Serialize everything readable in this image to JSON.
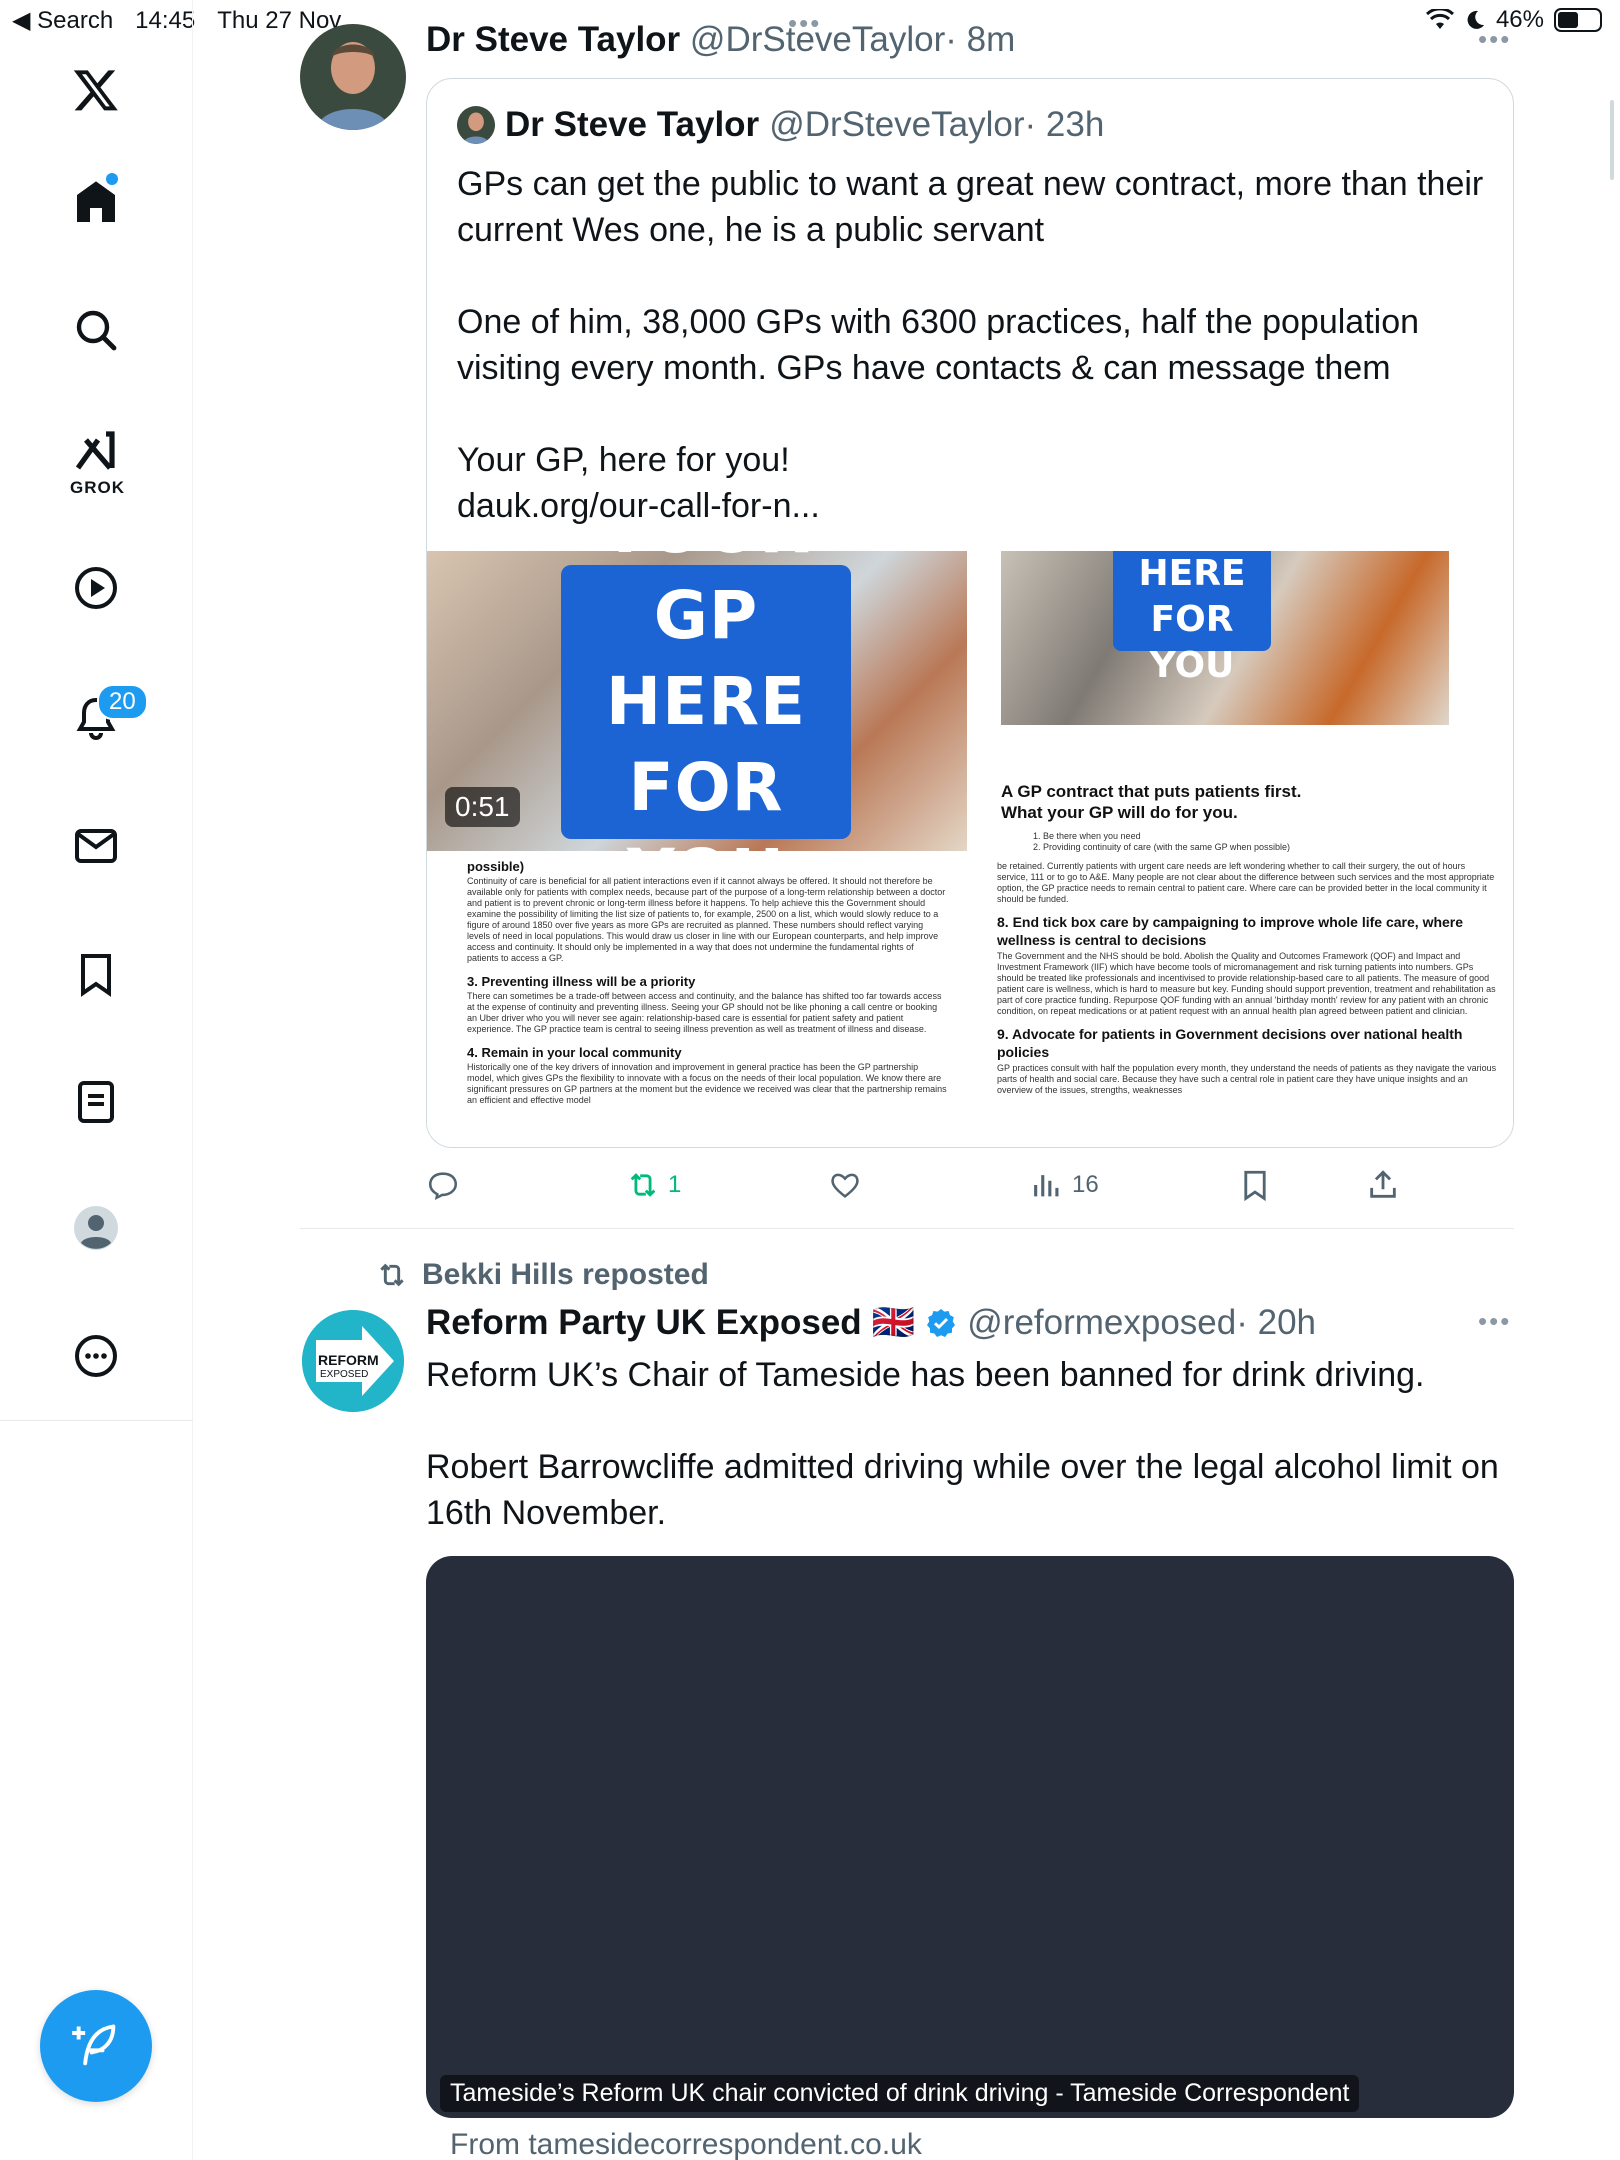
{
  "status_bar": {
    "back_label": "◀ Search",
    "time": "14:45",
    "date": "Thu 27 Nov",
    "battery": "46%"
  },
  "sidebar": {
    "grok_label": "GROK",
    "notifications_badge": "20",
    "items": [
      "home",
      "search",
      "grok",
      "video",
      "notifications",
      "messages",
      "bookmarks",
      "lists",
      "profile",
      "more"
    ]
  },
  "tweet1": {
    "author_name": "Dr Steve Taylor",
    "author_handle": "@DrSteveTaylor",
    "time": "· 8m",
    "quote": {
      "author_name": "Dr Steve Taylor",
      "author_handle": "@DrSteveTaylor",
      "time": "· 23h",
      "paragraphs": [
        "GPs can get the public to want a great new contract, more than their current Wes one, he is a public servant",
        "One of him, 38,000 GPs with 6300 practices, half the population visiting every month. GPs have contacts & can message them",
        "Your GP, here for you!\ndauk.org/our-call-for-n..."
      ],
      "media": {
        "video_title_lines": [
          "YOUR GP",
          "HERE",
          "FOR YOU"
        ],
        "duration": "0:51",
        "doc_left": {
          "intro_heading": "possible)",
          "intro_text": "Continuity of care is beneficial for all patient interactions even if it cannot always be offered. It should not therefore be available only for patients with complex needs, because part of the purpose of a long-term relationship between a doctor and patient is to prevent chronic or long-term illness before it happens. To help achieve this the Government should examine the possibility of limiting the list size of patients to, for example, 2500 on a list, which would slowly reduce to a figure of around 1850 over five years as more GPs are recruited as planned. These numbers should reflect varying levels of need in local populations. This would draw us closer in line with our European counterparts, and help improve access and continuity. It should only be implemented in a way that does not undermine the fundamental rights of patients to access a GP.",
          "h3": "3. Preventing illness will be a priority",
          "p3": "There can sometimes be a trade-off between access and continuity, and the balance has shifted too far towards access at the expense of continuity and preventing illness. Seeing your GP should not be like phoning a call centre or booking an Uber driver who you will never see again: relationship-based care is essential for patient safety and patient experience. The GP practice team is central to seeing illness prevention as well as treatment of illness and disease.",
          "h4": "4. Remain in your local community",
          "p4": "Historically one of the key drivers of innovation and improvement in general practice has been the GP partnership model, which gives GPs the flexibility to innovate with a focus on the needs of their local population. We know there are significant pressures on GP partners at the moment but the evidence we received was clear that the partnership remains an efficient and effective model"
        },
        "doc_right": {
          "banner_lines": [
            "HERE",
            "FOR YOU"
          ],
          "subtitle": "A GP contract that puts patients first.\nWhat your GP will do for you.",
          "list_1": "1.      Be there when you need",
          "list_2": "2.      Providing continuity of care (with the same GP when possible)",
          "p_intro": "be retained. Currently patients with urgent care needs are left wondering whether to call their surgery, the out of hours service, 111 or to go to A&E. Many people are not clear about the difference between such services and the most appropriate option, the GP practice needs to remain central to patient care. Where care can be provided better in the local community it should be funded.",
          "h8": "8. End tick box care by campaigning to improve whole life care, where wellness is central to decisions",
          "p8": "The Government and the NHS should be bold. Abolish the Quality and Outcomes Framework (QOF) and Impact and Investment Framework (IIF) which have become tools of micromanagement and risk turning patients into numbers. GPs should be treated like professionals and incentivised to provide relationship-based care to all patients. The measure of good patient care is wellness, which is hard to measure but key. Funding should support prevention, treatment and rehabilitation as part of core practice funding. Repurpose QOF funding with an annual 'birthday month' review for any patient with an chronic condition, on repeat medications or at patient request with an annual health plan agreed between patient and clinician.",
          "h9": "9. Advocate for patients in Government decisions over national health policies",
          "p9": "GP practices consult with half the population every month, they understand the needs of patients as they navigate the various parts of health and social care. Because they have such a central role in patient care they have unique insights and an overview of the issues, strengths, weaknesses"
        }
      }
    },
    "actions": {
      "reply": "",
      "repost": "1",
      "like": "",
      "views": "16"
    }
  },
  "tweet2": {
    "reposted_by": "Bekki Hills reposted",
    "avatar_text_1": "REFORM",
    "avatar_text_2": "EXPOSED",
    "author_name": "Reform Party UK Exposed",
    "flag": "🇬🇧",
    "author_handle": "@reformexposed",
    "time": "· 20h",
    "paragraphs": [
      "Reform UK’s Chair of Tameside has been banned for drink driving.",
      "Robert Barrowcliffe admitted driving while over the legal alcohol limit on 16th November."
    ],
    "link_card": {
      "caption": "Tameside’s Reform UK chair convicted of drink driving - Tameside Correspondent",
      "domain": "From tamesidecorrespondent.co.uk"
    }
  },
  "colors": {
    "accent": "#1d9bf0",
    "repost_green": "#00ba7c",
    "muted": "#536471",
    "link_card_bg": "#272d3a",
    "banner_blue": "#1c64d4"
  }
}
